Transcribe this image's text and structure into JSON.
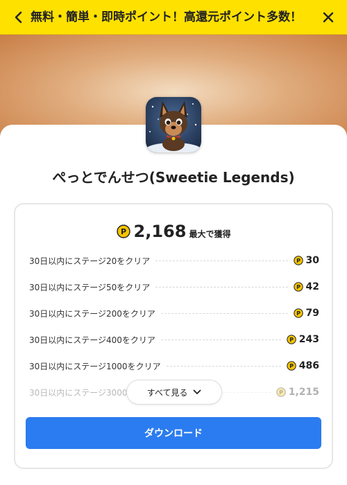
{
  "header": {
    "title": "無料・簡単・即時ポイント！高還元ポイント多数！",
    "back_icon": "chevron-left-icon",
    "close_icon": "close-icon",
    "background": "#ffe100"
  },
  "app": {
    "name": "ぺっとでんせつ(Sweetie Legends)",
    "icon": "app-icon-dog"
  },
  "reward": {
    "total": "2,168",
    "total_suffix": "最大で獲得",
    "coin_symbol": "P",
    "coin_color": "#f5c400",
    "tasks": [
      {
        "label": "30日以内にステージ20をクリア",
        "points": "30"
      },
      {
        "label": "30日以内にステージ50をクリア",
        "points": "42"
      },
      {
        "label": "30日以内にステージ200をクリア",
        "points": "79"
      },
      {
        "label": "30日以内にステージ400をクリア",
        "points": "243"
      },
      {
        "label": "30日以内にステージ1000をクリア",
        "points": "486"
      },
      {
        "label": "30日以内にステージ3000をクリア",
        "points": "1,215"
      }
    ]
  },
  "actions": {
    "see_all_label": "すべて見る",
    "download_label": "ダウンロード",
    "download_color": "#2b7cf0"
  }
}
